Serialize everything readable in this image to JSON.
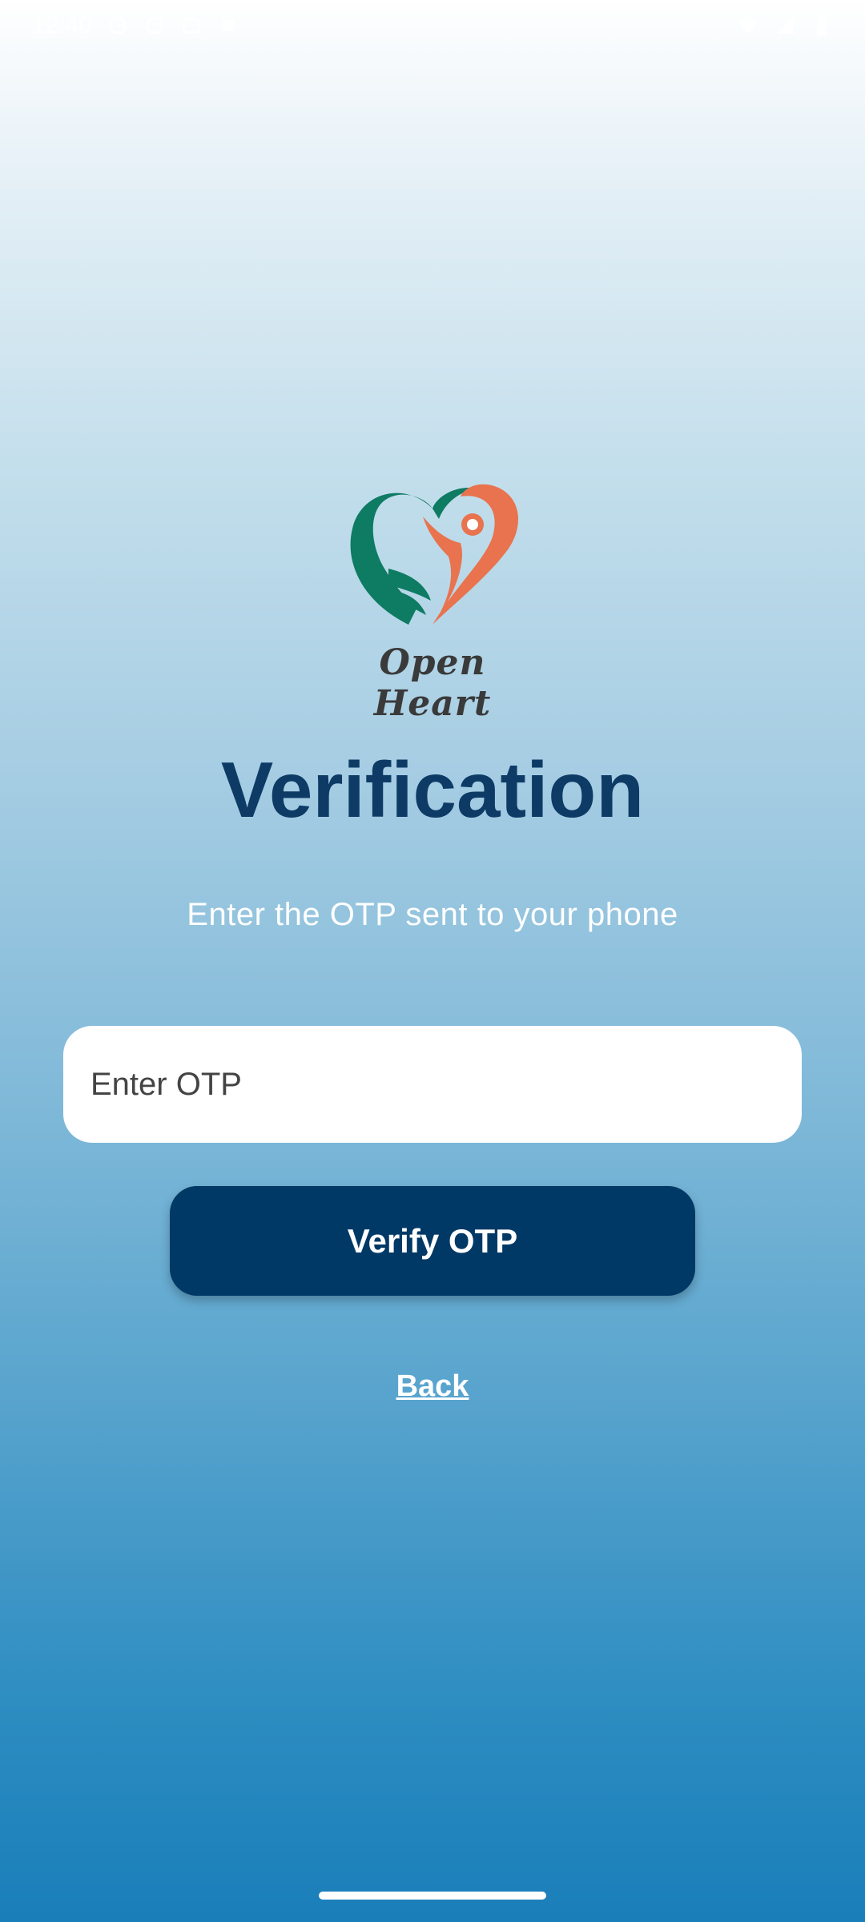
{
  "status_bar": {
    "time": "12:40",
    "left_icons": [
      "g-icon",
      "sync-icon",
      "media-icon",
      "square-icon"
    ],
    "right_icons": [
      "wifi-icon",
      "signal-icon",
      "battery-icon"
    ]
  },
  "logo": {
    "brand_name": "Open Heart",
    "colors": {
      "green": "#0e7b63",
      "orange": "#e8734e"
    }
  },
  "title": "Verification",
  "subtitle": "Enter the OTP sent to your phone",
  "otp_field": {
    "placeholder": "Enter OTP",
    "value": ""
  },
  "verify_button": {
    "label": "Verify OTP",
    "color": "#003966"
  },
  "back_link": {
    "label": "Back"
  },
  "colors": {
    "title": "#0d3b66",
    "gradient_top": "#ffffff",
    "gradient_bottom": "#1a7eb9"
  }
}
